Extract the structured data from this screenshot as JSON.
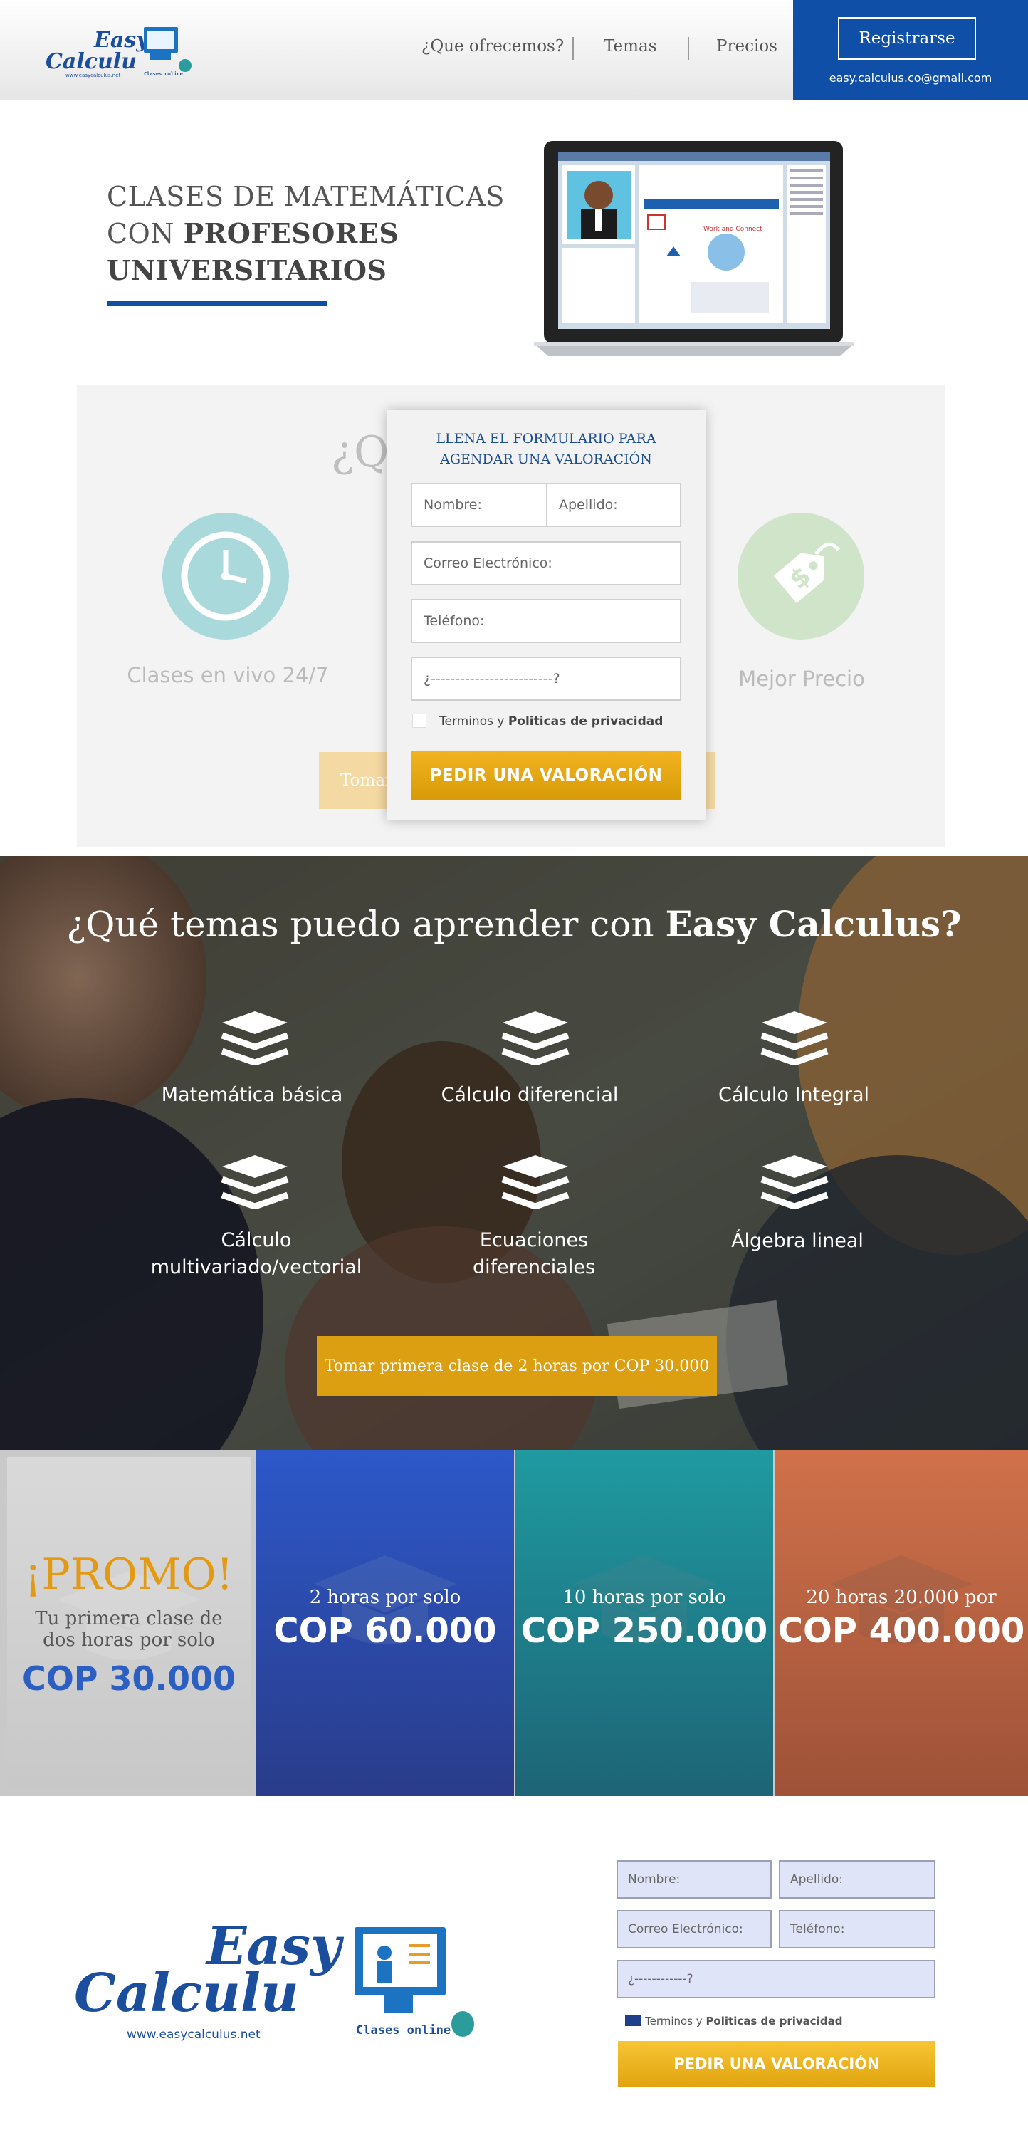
{
  "header": {
    "logo": {
      "word1": "Easy",
      "word2": "Calculu",
      "url": "www.easycalculus.net",
      "tagline": "Clases online"
    },
    "nav": [
      "¿Que ofrecemos?",
      "Temas",
      "Precios"
    ],
    "register_label": "Registrarse",
    "email": "easy.calculus.co@gmail.com",
    "colors": {
      "brand_blue": "#0f4fa8"
    }
  },
  "hero": {
    "line1": "CLASES DE MATEMÁTICAS",
    "line2a": "CON ",
    "line2b": "PROFESORES",
    "line3": "UNIVERSITARIOS",
    "image": "laptop-screenshot"
  },
  "benefits": {
    "title_partial": "¿Qu",
    "items": [
      {
        "icon": "clock-icon",
        "label": "Clases en vivo 24/7"
      },
      {
        "icon": "price-tag-icon",
        "label": "Mejor Precio"
      }
    ],
    "cta_partial": "Tomar"
  },
  "form": {
    "title_line1": "LLENA EL FORMULARIO PARA",
    "title_line2": "AGENDAR UNA VALORACIÓN",
    "first_name": "Nombre:",
    "last_name": "Apellido:",
    "email": "Correo Electrónico:",
    "phone": "Teléfono:",
    "question": "¿-------------------------?",
    "terms_prefix": "Terminos y ",
    "terms_link": "Politicas de privacidad",
    "submit": "PEDIR UNA VALORACIÓN",
    "colors": {
      "submit": "#e4a514"
    }
  },
  "topics": {
    "title_prefix": "¿Qué temas puedo aprender con ",
    "title_brand": "Easy Calculus?",
    "items": [
      {
        "icon": "books-icon",
        "label": "Matemática básica"
      },
      {
        "icon": "books-icon",
        "label": "Cálculo diferencial"
      },
      {
        "icon": "books-icon",
        "label": "Cálculo Integral"
      },
      {
        "icon": "books-icon",
        "label": "Cálculo multivariado/vectorial"
      },
      {
        "icon": "books-icon",
        "label": "Ecuaciones diferenciales"
      },
      {
        "icon": "books-icon",
        "label": "Álgebra lineal"
      }
    ],
    "cta": "Tomar primera clase de  2 horas por COP 30.000"
  },
  "pricing": [
    {
      "headline": "¡PROMO!",
      "line1": "Tu primera clase de",
      "line2": "dos horas por solo",
      "price": "COP 30.000",
      "colors": {
        "bg": "#d4d4d4",
        "headline": "#e39a12",
        "price": "#2b5fc2"
      }
    },
    {
      "caption": "2 horas por solo",
      "price": "COP 60.000",
      "colors": {
        "top": "#2c58c9",
        "bottom": "#2a3c8a"
      }
    },
    {
      "caption": "10 horas por solo",
      "price": "COP 250.000",
      "colors": {
        "top": "#1f9aa0",
        "bottom": "#1d6476"
      }
    },
    {
      "caption": "20 horas 20.000 por",
      "price": "COP 400.000",
      "colors": {
        "top": "#d0714a",
        "bottom": "#9e5238"
      }
    }
  ],
  "footer_form": {
    "first_name": "Nombre:",
    "last_name": "Apellido:",
    "email": "Correo Electrónico:",
    "phone": "Teléfono:",
    "question": "¿------------?",
    "terms_prefix": "Terminos y ",
    "terms_link": "Politicas de privacidad",
    "submit": "PEDIR UNA VALORACIÓN"
  }
}
